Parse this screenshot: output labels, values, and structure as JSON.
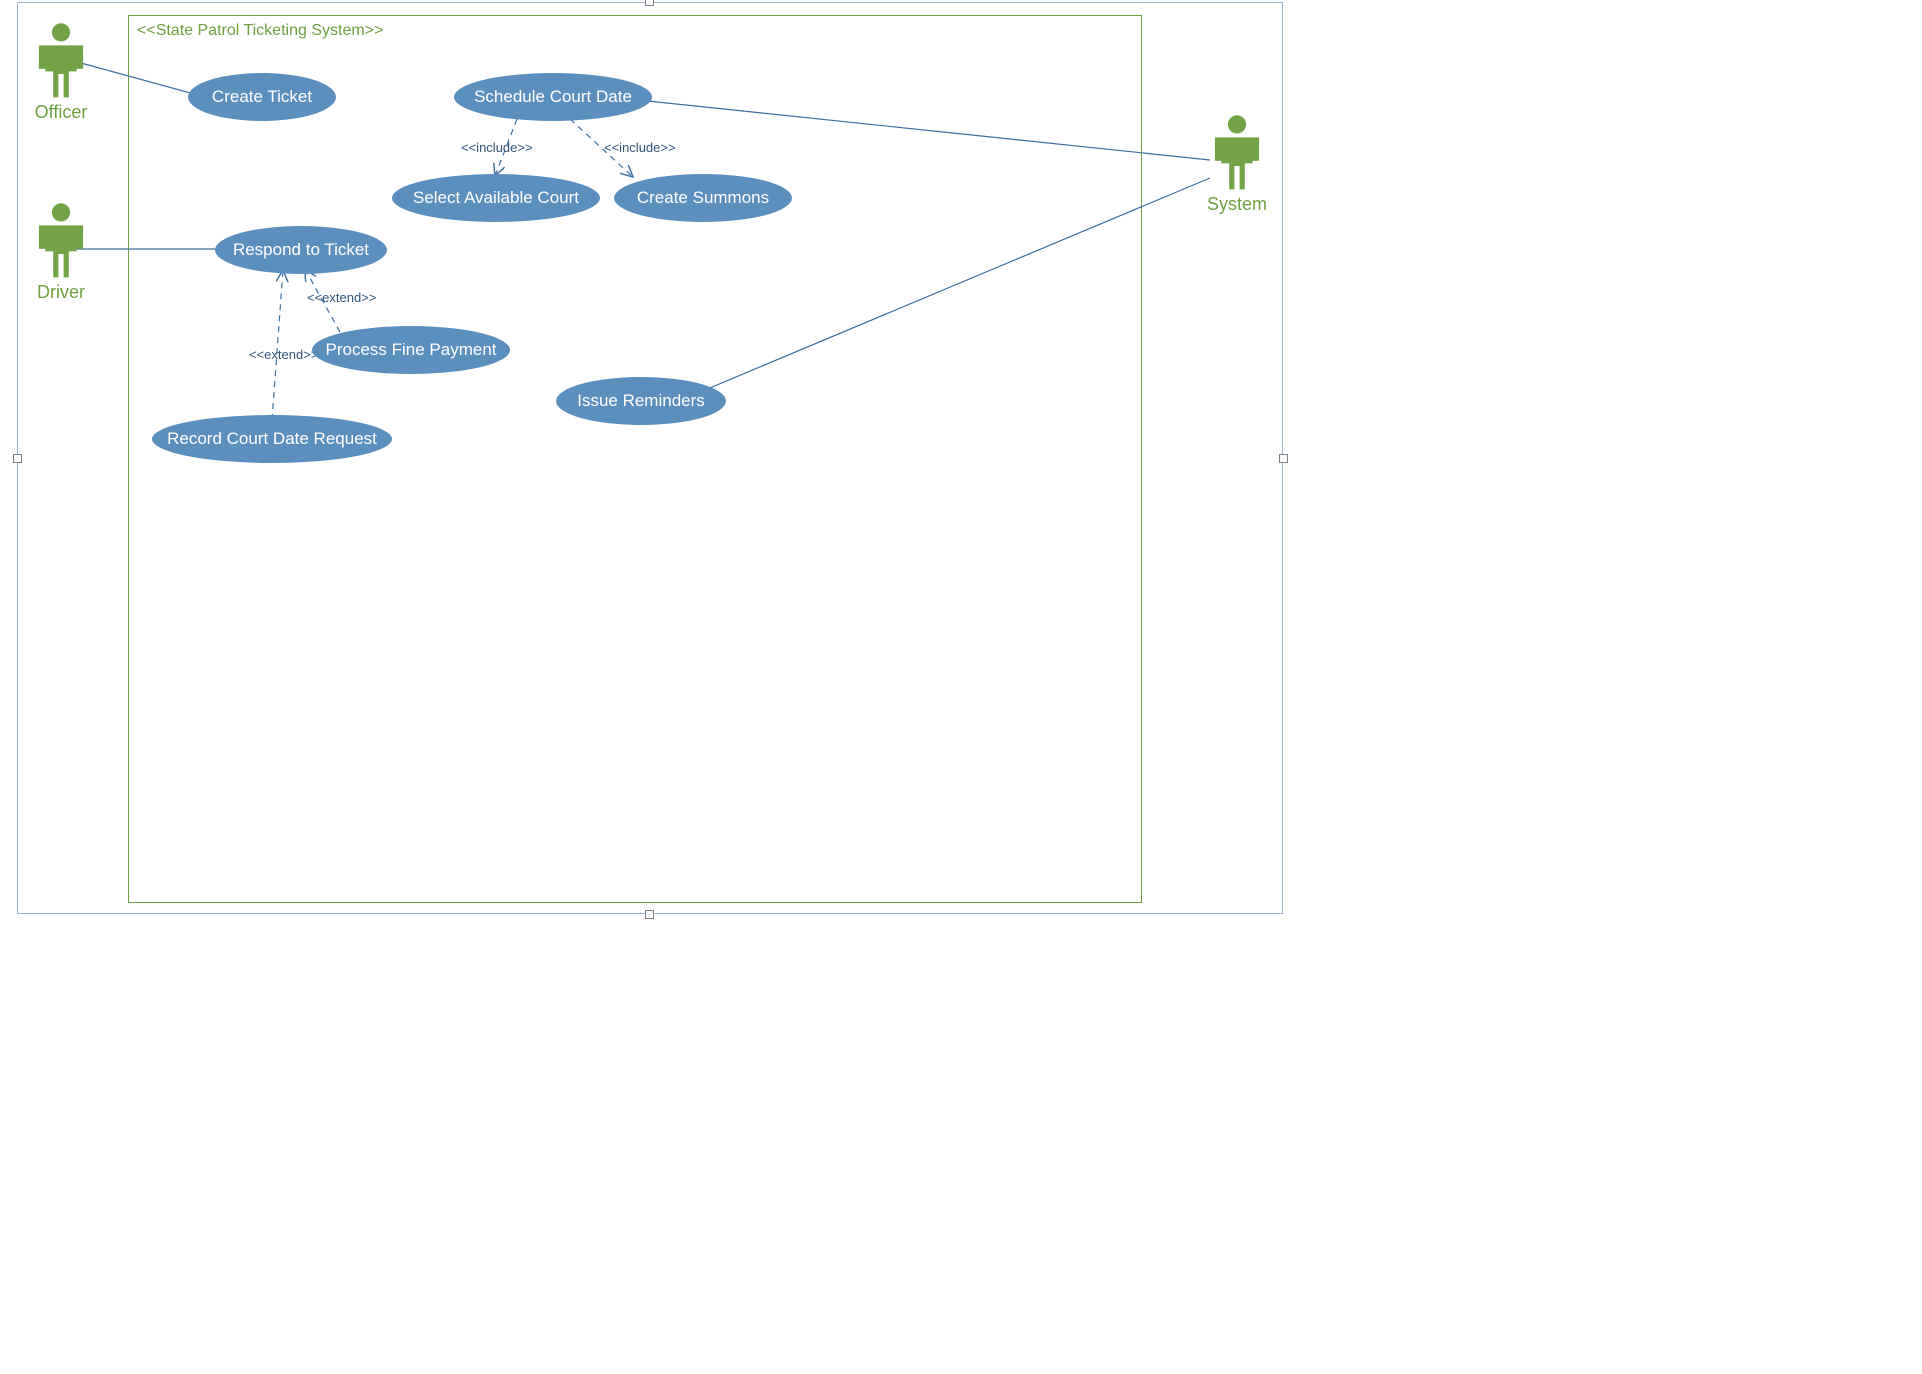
{
  "system": {
    "title": "<<State Patrol Ticketing System>>"
  },
  "actors": {
    "officer": "Officer",
    "driver": "Driver",
    "system": "System"
  },
  "usecases": {
    "createTicket": "Create Ticket",
    "scheduleCourtDate": "Schedule Court Date",
    "selectAvailableCourt": "Select Available Court",
    "createSummons": "Create Summons",
    "respondToTicket": "Respond to Ticket",
    "processFinePayment": "Process Fine Payment",
    "recordCourtDateRequest": "Record Court Date Request",
    "issueReminders": "Issue Reminders"
  },
  "stereotypes": {
    "include1": "<<include>>",
    "include2": "<<include>>",
    "extend1": "<<extend>>",
    "extend2": "<<extend>>"
  },
  "colors": {
    "actorGreen": "#72a346",
    "usecaseBlue": "#5b8fbe",
    "borderGreen": "#6fa03f",
    "connectorBlue": "#3f6f9e",
    "labelBlue": "#33547a"
  }
}
